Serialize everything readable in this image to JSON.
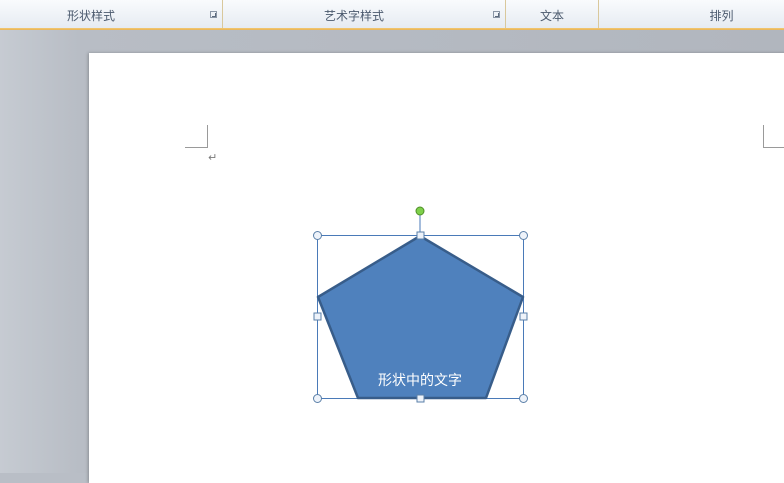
{
  "ribbon": {
    "groups": [
      {
        "label": "形状样式",
        "has_launcher": true
      },
      {
        "label": "艺术字样式",
        "has_launcher": true
      },
      {
        "label": "文本",
        "has_launcher": false
      },
      {
        "label": "排列",
        "has_launcher": false
      }
    ],
    "accent_color": "#e6b356"
  },
  "document": {
    "paragraph_mark": "↵",
    "shape": {
      "type": "pentagon",
      "text": "形状中的文字",
      "fill_color": "#4f81bd",
      "outline_color": "#385d8a",
      "rotation_handle_color": "#7ed04b",
      "selected": true
    }
  }
}
